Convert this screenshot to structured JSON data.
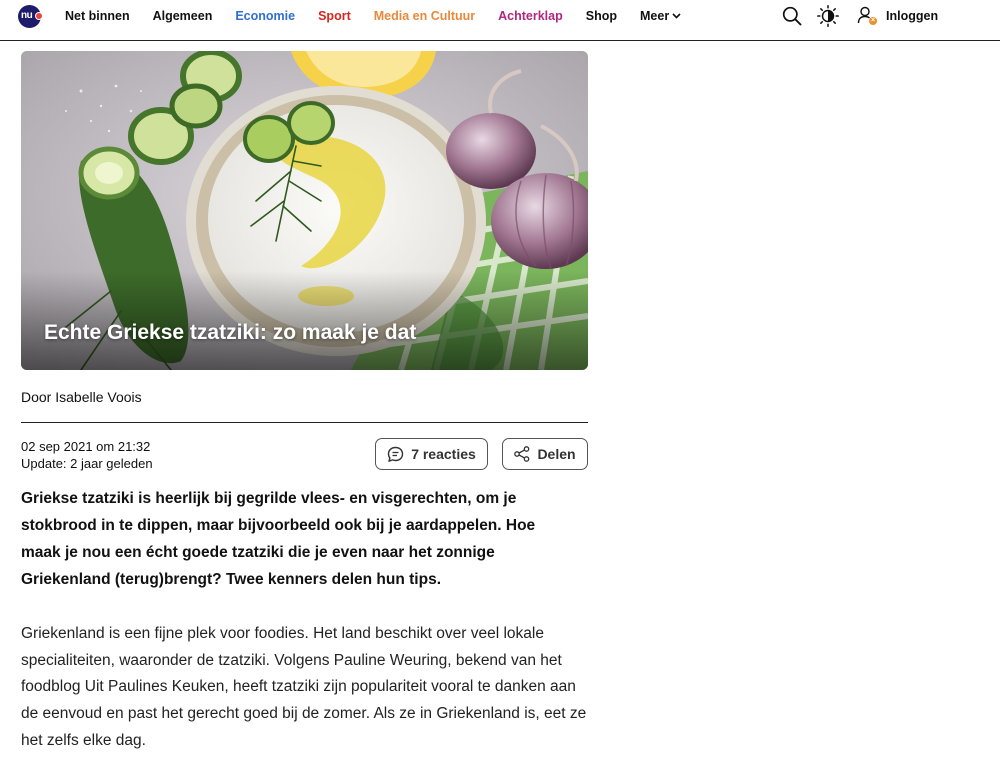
{
  "nav": {
    "logo_text": "nu",
    "items": [
      {
        "label": "Net binnen",
        "color": "#111111"
      },
      {
        "label": "Algemeen",
        "color": "#111111"
      },
      {
        "label": "Economie",
        "color": "#2f6fcf"
      },
      {
        "label": "Sport",
        "color": "#d8261f"
      },
      {
        "label": "Media en Cultuur",
        "color": "#e8893a"
      },
      {
        "label": "Achterklap",
        "color": "#b0277f"
      },
      {
        "label": "Shop",
        "color": "#111111"
      }
    ],
    "more_label": "Meer",
    "login_label": "Inloggen",
    "icons": [
      "search-icon",
      "contrast-icon",
      "user-icon"
    ]
  },
  "article": {
    "title": "Echte Griekse tzatziki: zo maak je dat",
    "byline": "Door Isabelle Voois",
    "date": "02 sep 2021 om 21:32",
    "update": "Update: 2 jaar geleden",
    "reactions_label": "7 reacties",
    "share_label": "Delen",
    "lead": "Griekse tzatziki is heerlijk bij gegrilde vlees- en visgerechten, om je stokbrood in te dippen, maar bijvoorbeeld ook bij je aardappelen. Hoe maak je nou een écht goede tzatziki die je even naar het zonnige Griekenland (terug)brengt? Twee kenners delen hun tips.",
    "paragraph": "Griekenland is een fijne plek voor foodies. Het land beschikt over veel lokale specialiteiten, waaronder de tzatziki. Volgens Pauline Weuring, bekend van het foodblog Uit Paulines Keuken, heeft tzatziki zijn populariteit vooral te danken aan de eenvoud en past het gerecht goed bij de zomer. Als ze in Griekenland is, eet ze het zelfs elke dag."
  }
}
